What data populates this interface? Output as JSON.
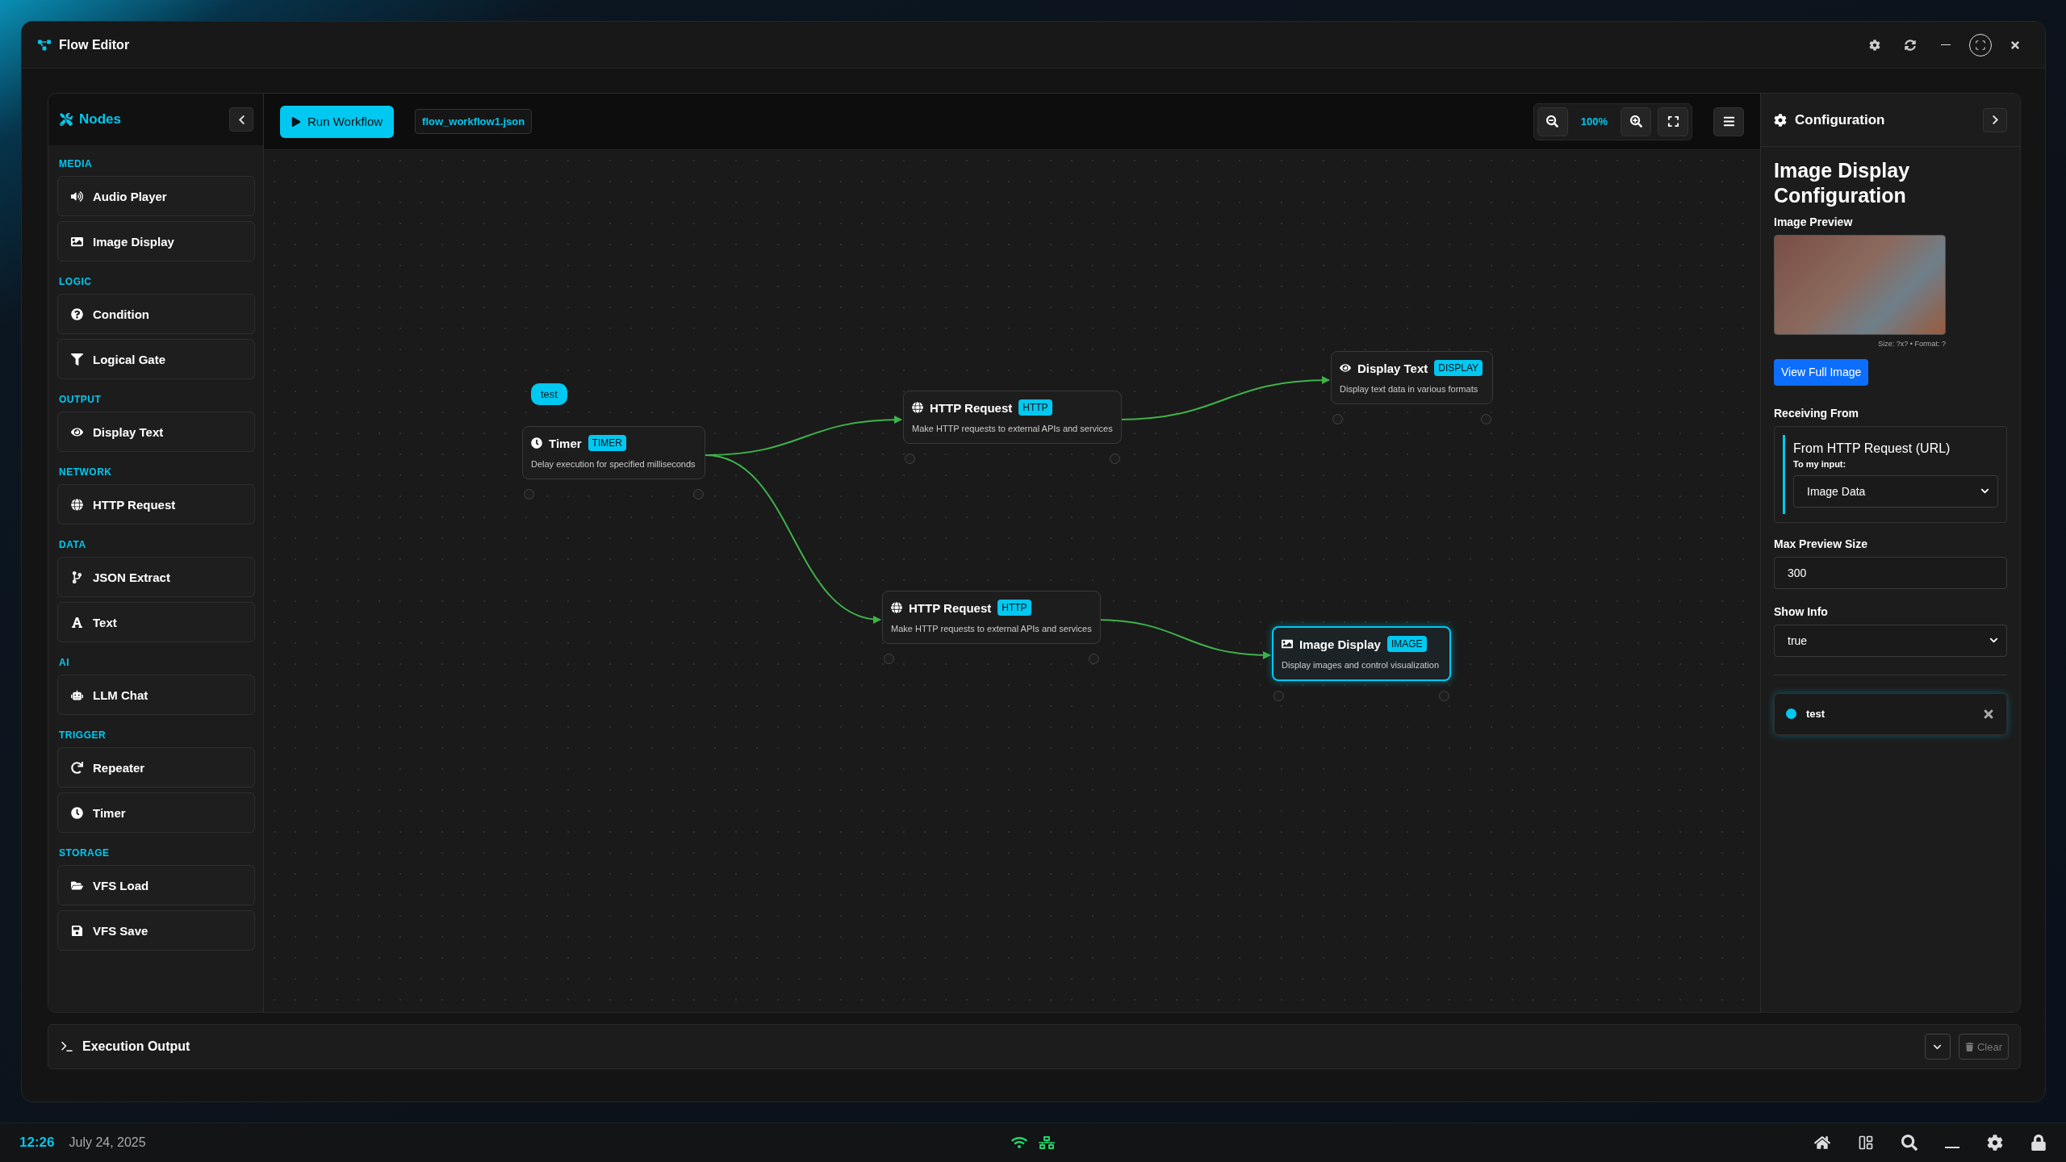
{
  "window": {
    "title": "Flow Editor"
  },
  "sidebar": {
    "title": "Nodes",
    "sections": [
      {
        "label": "MEDIA",
        "items": [
          {
            "label": "Audio Player"
          },
          {
            "label": "Image Display"
          }
        ]
      },
      {
        "label": "LOGIC",
        "items": [
          {
            "label": "Condition"
          },
          {
            "label": "Logical Gate"
          }
        ]
      },
      {
        "label": "OUTPUT",
        "items": [
          {
            "label": "Display Text"
          }
        ]
      },
      {
        "label": "NETWORK",
        "items": [
          {
            "label": "HTTP Request"
          }
        ]
      },
      {
        "label": "DATA",
        "items": [
          {
            "label": "JSON Extract"
          },
          {
            "label": "Text"
          }
        ]
      },
      {
        "label": "AI",
        "items": [
          {
            "label": "LLM Chat"
          }
        ]
      },
      {
        "label": "TRIGGER",
        "items": [
          {
            "label": "Repeater"
          },
          {
            "label": "Timer"
          }
        ]
      },
      {
        "label": "STORAGE",
        "items": [
          {
            "label": "VFS Load"
          },
          {
            "label": "VFS Save"
          }
        ]
      }
    ]
  },
  "toolbar": {
    "run_button": "Run Workflow",
    "file_name": "flow_workflow1.json",
    "zoom": "100%"
  },
  "canvas": {
    "group_label": "test",
    "nodes": [
      {
        "kind": "timer",
        "title": "Timer",
        "badge": "TIMER",
        "description": "Delay execution for specified milliseconds",
        "selected": false
      },
      {
        "kind": "http",
        "title": "HTTP Request",
        "badge": "HTTP",
        "description": "Make HTTP requests to external APIs and services",
        "selected": false
      },
      {
        "kind": "display",
        "title": "Display Text",
        "badge": "DISPLAY",
        "description": "Display text data in various formats",
        "selected": false
      },
      {
        "kind": "http",
        "title": "HTTP Request",
        "badge": "HTTP",
        "description": "Make HTTP requests to external APIs and services",
        "selected": false
      },
      {
        "kind": "image",
        "title": "Image Display",
        "badge": "IMAGE",
        "description": "Display images and control visualization",
        "selected": true
      }
    ]
  },
  "config": {
    "title": "Configuration",
    "heading": "Image Display Configuration",
    "preview_label": "Image Preview",
    "image_info": "Size: ?x? • Format: ?",
    "view_button": "View Full Image",
    "receiving_label": "Receiving From",
    "source": "From HTTP Request (URL)",
    "input_label": "To my input:",
    "input_value": "Image Data",
    "fields": [
      {
        "label": "Max Preview Size",
        "kind": "text",
        "value": "300"
      },
      {
        "label": "Show Info",
        "kind": "select",
        "value": "true"
      }
    ],
    "notification": "test"
  },
  "output": {
    "title": "Execution Output",
    "clear_button": "Clear",
    "clear_disabled": true
  },
  "taskbar": {
    "time": "12:26",
    "date": "July 24, 2025"
  }
}
